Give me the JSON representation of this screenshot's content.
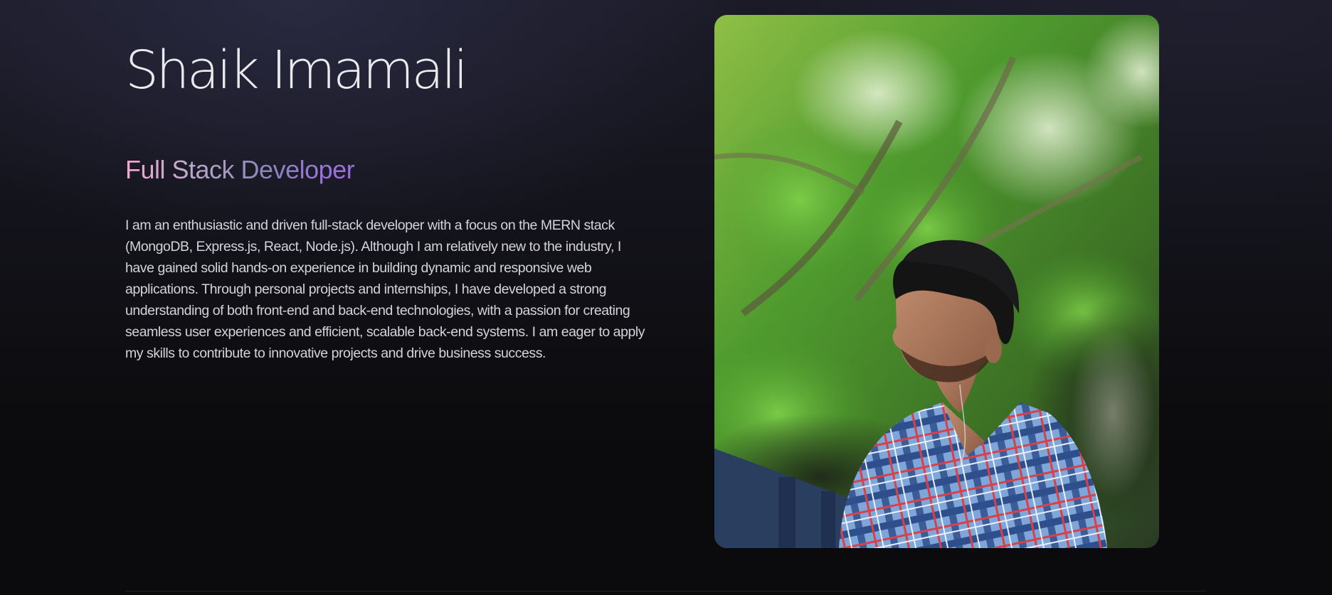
{
  "hero": {
    "name": "Shaik Imamali",
    "role": "Full Stack Developer",
    "bio": "I am an enthusiastic and driven full-stack developer with a focus on the MERN stack (MongoDB, Express.js, React, Node.js). Although I am relatively new to the industry, I have gained solid hands-on experience in building dynamic and responsive web applications. Through personal projects and internships, I have developed a strong understanding of both front-end and back-end technologies, with a passion for creating seamless user experiences and efficient, scalable back-end systems. I am eager to apply my skills to contribute to innovative projects and drive business success."
  },
  "portrait": {
    "icon": "person-photo",
    "shirt_pattern": "blue plaid with red stripes",
    "background": "green foliage"
  },
  "colors": {
    "page_background": "#0b0b0d",
    "name_text": "#e9e9ee",
    "bio_text": "#d3d3da",
    "role_gradient_start": "#f4a6d2",
    "role_gradient_end": "#9f6be8"
  }
}
